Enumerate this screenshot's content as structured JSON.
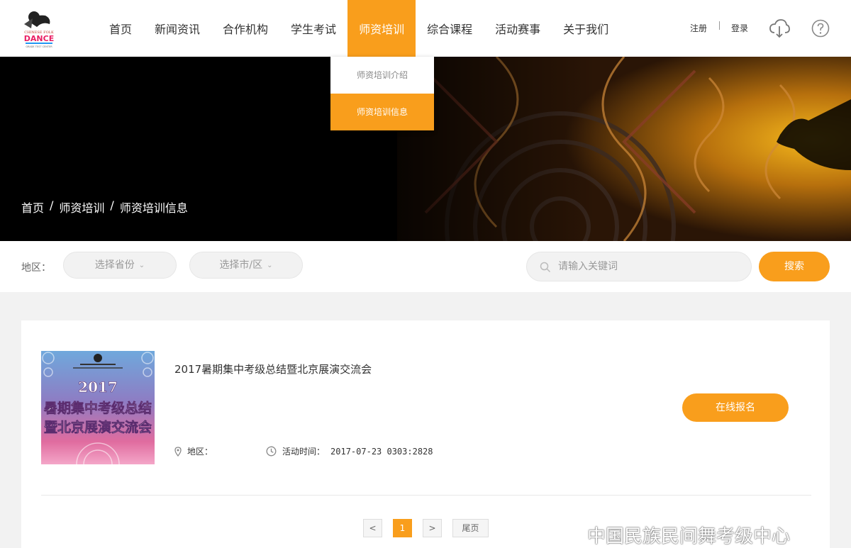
{
  "header": {
    "logo_text": "CHINESE FOLK DANCE",
    "nav": [
      {
        "label": "首页"
      },
      {
        "label": "新闻资讯"
      },
      {
        "label": "合作机构"
      },
      {
        "label": "学生考试"
      },
      {
        "label": "师资培训",
        "active": true
      },
      {
        "label": "综合课程"
      },
      {
        "label": "活动赛事"
      },
      {
        "label": "关于我们"
      }
    ],
    "register": "注册",
    "login": "登录",
    "download_icon": "cloud-download-icon",
    "help_icon": "question-circle-icon"
  },
  "dropdown": {
    "items": [
      {
        "label": "师资培训介绍"
      },
      {
        "label": "师资培训信息",
        "active": true
      }
    ]
  },
  "breadcrumb": {
    "items": [
      "首页",
      "/",
      "师资培训",
      "/",
      "师资培训信息"
    ]
  },
  "filter": {
    "label": "地区：",
    "province": "选择省份",
    "city": "选择市/区",
    "search_placeholder": "请输入关键词",
    "search_button": "搜索"
  },
  "item": {
    "title": "2017暑期集中考级总结暨北京展演交流会",
    "region_label": "地区：",
    "region_value": "",
    "time_label": "活动时间：",
    "time_value": "2017-07-23 0303:2828",
    "signup": "在线报名",
    "thumb_year": "2017",
    "thumb_line1": "暑期集中考级总结",
    "thumb_line2": "暨北京展演交流会"
  },
  "pagination": {
    "prev": "<",
    "current": "1",
    "next": ">",
    "last": "尾页"
  },
  "watermark": "中国民族民间舞考级中心",
  "colors": {
    "accent": "#f99e1c",
    "background": "#f2f2f2"
  }
}
